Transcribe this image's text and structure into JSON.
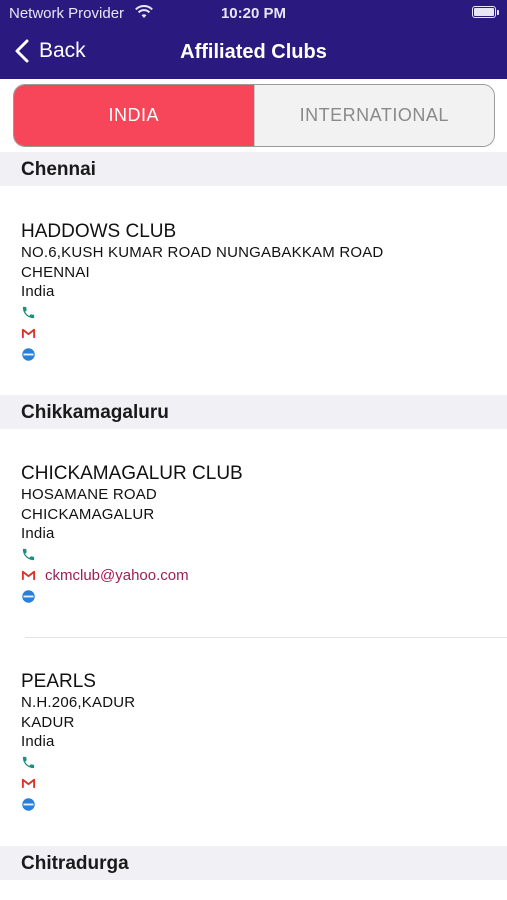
{
  "status_bar": {
    "carrier": "Network Provider",
    "time": "10:20 PM"
  },
  "nav": {
    "back_label": "Back",
    "title": "Affiliated Clubs"
  },
  "segments": [
    {
      "label": "INDIA",
      "selected": true
    },
    {
      "label": "INTERNATIONAL",
      "selected": false
    }
  ],
  "sections": [
    {
      "city": "Chennai",
      "clubs": [
        {
          "name": "HADDOWS CLUB",
          "address1": "NO.6,KUSH KUMAR ROAD NUNGABAKKAM ROAD",
          "address2": "CHENNAI",
          "country": "India",
          "email": ""
        }
      ]
    },
    {
      "city": "Chikkamagaluru",
      "clubs": [
        {
          "name": "CHICKAMAGALUR CLUB",
          "address1": "HOSAMANE ROAD",
          "address2": "CHICKAMAGALUR",
          "country": "India",
          "email": "ckmclub@yahoo.com"
        },
        {
          "name": "PEARLS",
          "address1": "N.H.206,KADUR",
          "address2": "KADUR",
          "country": "India",
          "email": ""
        }
      ]
    },
    {
      "city": "Chitradurga",
      "clubs": []
    }
  ],
  "colors": {
    "nav_bg": "#2a1a80",
    "segment_active": "#f7455a",
    "phone_icon": "#1a8f7a",
    "email_icon": "#d8342b",
    "email_text": "#9c1f57",
    "web_icon": "#2a7fd6"
  },
  "icons": {
    "phone": "phone-icon",
    "email": "gmail-icon",
    "web": "web-icon"
  }
}
